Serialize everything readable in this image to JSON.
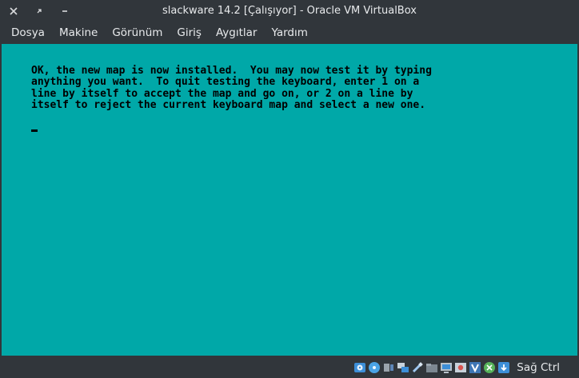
{
  "window": {
    "title": "slackware 14.2 [Çalışıyor] - Oracle VM VirtualBox"
  },
  "menu": {
    "items": [
      "Dosya",
      "Makine",
      "Görünüm",
      "Giriş",
      "Aygıtlar",
      "Yardım"
    ]
  },
  "console": {
    "text": "OK, the new map is now installed.  You may now test it by typing\nanything you want.  To quit testing the keyboard, enter 1 on a\nline by itself to accept the map and go on, or 2 on a line by\nitself to reject the current keyboard map and select a new one."
  },
  "statusbar": {
    "icons": [
      "hard-disk-icon",
      "optical-disk-icon",
      "audio-icon",
      "network-icon",
      "usb-icon",
      "shared-folders-icon",
      "display-icon",
      "video-capture-icon",
      "virtualization-icon",
      "mouse-integration-icon",
      "keyboard-icon"
    ],
    "host_key": "Sağ Ctrl"
  },
  "colors": {
    "chrome": "#31363b",
    "screen": "#00a8a8",
    "text": "#000000"
  }
}
